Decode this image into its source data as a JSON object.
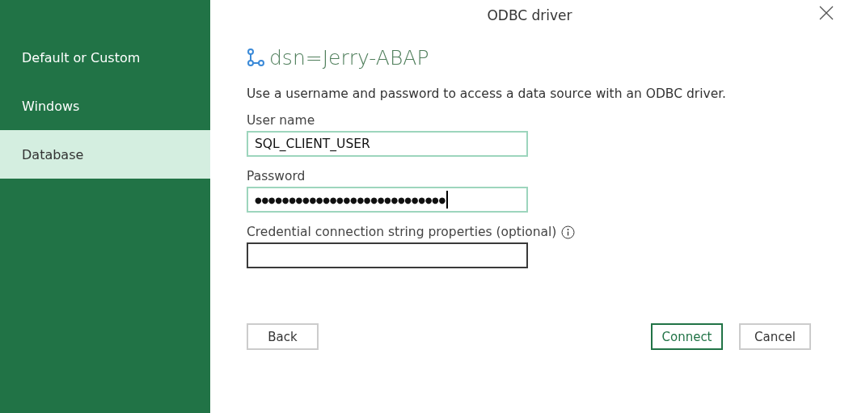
{
  "window": {
    "title": "ODBC driver"
  },
  "sidebar": {
    "items": [
      {
        "label": "Default or Custom",
        "selected": false
      },
      {
        "label": "Windows",
        "selected": false
      },
      {
        "label": "Database",
        "selected": true
      }
    ]
  },
  "heading": "dsn=Jerry-ABAP",
  "description": "Use a username and password to access a data source with an ODBC driver.",
  "fields": [
    {
      "label": "User name",
      "value": "SQL_CLIENT_USER",
      "focused": false,
      "info": false
    },
    {
      "label": "Password",
      "value": "●●●●●●●●●●●●●●●●●●●●●●●●●●●●",
      "focused": true,
      "info": false
    },
    {
      "label": "Credential connection string properties (optional)",
      "focused": false,
      "info": true
    }
  ],
  "buttons": [
    {
      "label": "Back",
      "primary": false
    },
    {
      "label": "Connect",
      "primary": true
    },
    {
      "label": "Cancel",
      "primary": false
    }
  ]
}
